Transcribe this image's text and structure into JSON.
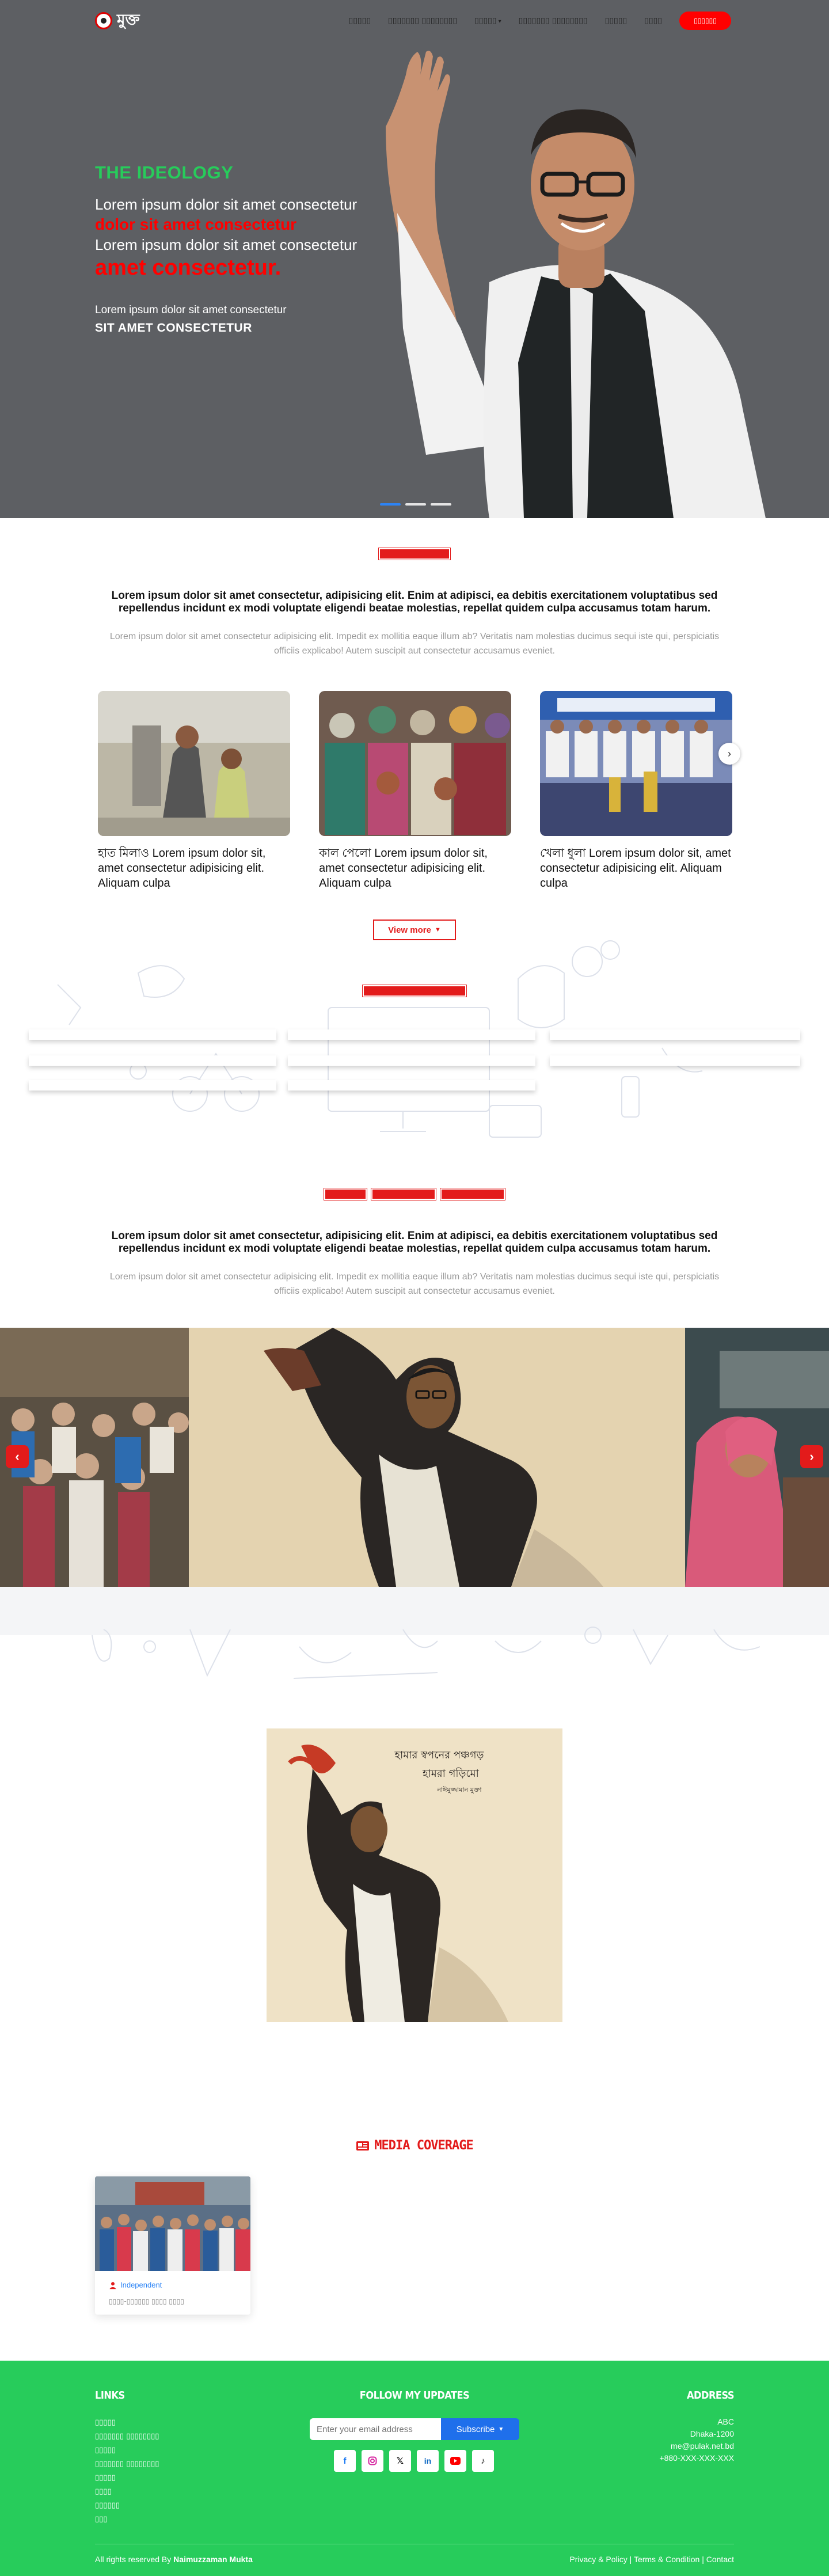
{
  "nav": {
    "logo_text": "মুক্ত",
    "links": [
      {
        "label": "▯▯▯▯▯"
      },
      {
        "label": "▯▯▯▯▯▯▯ ▯▯▯▯▯▯▯▯"
      },
      {
        "label": "▯▯▯▯▯",
        "has_dropdown": true
      },
      {
        "label": "▯▯▯▯▯▯▯ ▯▯▯▯▯▯▯▯"
      },
      {
        "label": "▯▯▯▯▯"
      },
      {
        "label": "▯▯▯▯"
      }
    ],
    "cta_label": "▯▯▯▯▯▯"
  },
  "hero": {
    "tag": "THE IDEOLOGY",
    "line1": "Lorem ipsum dolor sit amet consectetur",
    "red1": "dolor sit amet consectetur",
    "line2": "Lorem ipsum dolor sit amet consectetur",
    "red2": "amet consectetur.",
    "small": "Lorem ipsum dolor sit amet consectetur",
    "caps": "SIT AMET CONSECTETUR",
    "slides": 3,
    "active_slide": 0
  },
  "activities": {
    "lead": "Lorem ipsum dolor sit amet consectetur, adipisicing elit. Enim at adipisci, ea debitis exercitationem voluptatibus sed repellendus incidunt ex modi voluptate eligendi beatae molestias, repellat quidem culpa accusamus totam harum.",
    "sub": "Lorem ipsum dolor sit amet consectetur adipisicing elit. Impedit ex mollitia eaque illum ab? Veritatis nam molestias ducimus sequi iste qui, perspiciatis officiis explicabo! Autem suscipit aut consectetur accusamus eveniet.",
    "cards": [
      {
        "text": "হাত মিলাও Lorem ipsum dolor sit, amet consectetur adipisicing elit. Aliquam culpa"
      },
      {
        "text": "কাল পেলো Lorem ipsum dolor sit, amet consectetur adipisicing elit. Aliquam culpa"
      },
      {
        "text": "খেলা ধুলা Lorem ipsum dolor sit, amet consectetur adipisicing elit. Aliquam culpa"
      }
    ],
    "view_more": "View more"
  },
  "videos": {
    "lead": "Lorem ipsum dolor sit amet consectetur, adipisicing elit. Enim at adipisci, ea debitis exercitationem voluptatibus sed repellendus incidunt ex modi voluptate eligendi beatae molestias, repellat quidem culpa accusamus totam harum.",
    "sub": "Lorem ipsum dolor sit amet consectetur adipisicing elit. Impedit ex mollitia eaque illum ab? Veritatis nam molestias ducimus sequi iste qui, perspiciatis officiis explicabo! Autem suscipit aut consectetur accusamus eveniet."
  },
  "poster": {
    "line1": "হামার স্বপনের পঞ্চগড়",
    "line2": "হামরা গড়িমো",
    "line3": "নাঈমুজ্জামান মুক্তা"
  },
  "media": {
    "title": "MEDIA COVERAGE",
    "source": "Independent",
    "desc": "▯▯▯▯-▯▯▯▯▯▯ ▯▯▯▯ ▯▯▯▯"
  },
  "footer": {
    "links_title": "LINKS",
    "links": [
      "▯▯▯▯▯",
      "▯▯▯▯▯▯▯ ▯▯▯▯▯▯▯▯",
      "▯▯▯▯▯",
      "▯▯▯▯▯▯▯ ▯▯▯▯▯▯▯▯",
      "▯▯▯▯▯",
      "▯▯▯▯",
      "▯▯▯▯▯▯",
      "▯▯▯"
    ],
    "follow_title": "FOLLOW MY UPDATES",
    "email_placeholder": "Enter your email address",
    "subscribe_label": "Subscribe",
    "address_title": "ADDRESS",
    "address_lines": [
      "ABC",
      "Dhaka-1200",
      "me@pulak.net.bd",
      "+880-XXX-XXX-XXX"
    ],
    "copyright_prefix": "All rights reserved By",
    "copyright_name": "Naimuzzaman Mukta",
    "privacy": "Privacy & Policy",
    "terms": "Terms & Condition",
    "contact": "Contact"
  },
  "colors": {
    "accent_red": "#e31b1b",
    "brand_green": "#27cc5b",
    "link_blue": "#2d84f5"
  }
}
